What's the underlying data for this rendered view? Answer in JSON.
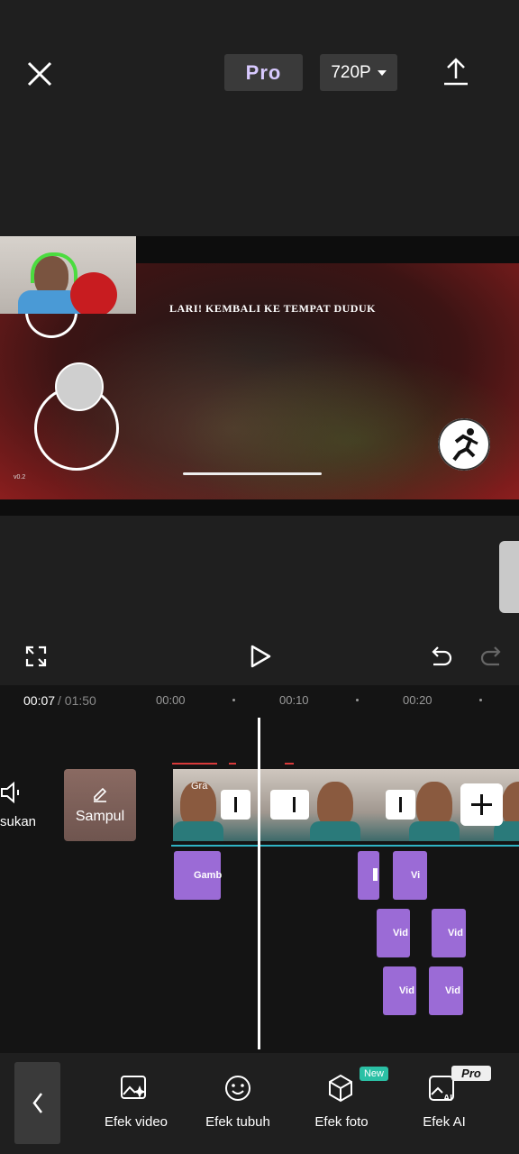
{
  "topbar": {
    "pro_label": "Pro",
    "resolution": "720P"
  },
  "preview": {
    "game_text": "LARI! KEMBALI KE TEMPAT DUDUK",
    "version": "v0.2"
  },
  "timeline": {
    "current_time": "00:07",
    "total_time": " / 01:50",
    "ticks": [
      "00:00",
      "00:10",
      "00:20"
    ],
    "audio_label": "sukan",
    "cover_label": "Sampul",
    "strip_label": "Gra",
    "fx_labels": [
      "Gamb",
      "Vi",
      "Vid",
      "Vid",
      "Vid",
      "Vid"
    ]
  },
  "toolbar": {
    "items": [
      {
        "label": "Efek video",
        "icon": "video-effect-icon"
      },
      {
        "label": "Efek tubuh",
        "icon": "body-effect-icon"
      },
      {
        "label": "Efek foto",
        "icon": "photo-effect-icon"
      },
      {
        "label": "Efek AI",
        "icon": "ai-effect-icon"
      }
    ],
    "new_badge": "New",
    "pro_badge": "Pro"
  },
  "colors": {
    "background": "#1f1f1f",
    "effect_clip": "#9b6bd6",
    "track_line": "#2fb3c4",
    "new_badge": "#2bc0a5"
  }
}
